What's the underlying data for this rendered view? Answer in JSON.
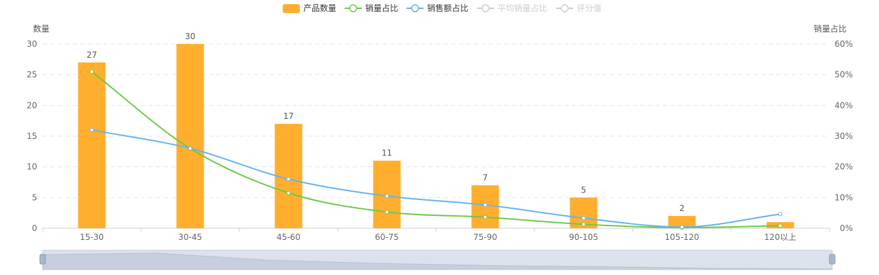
{
  "chart_data": {
    "type": "bar",
    "categories": [
      "15-30",
      "30-45",
      "45-60",
      "60-75",
      "75-90",
      "90-105",
      "105-120",
      "120以上"
    ],
    "y_left": {
      "name": "数量",
      "min": 0,
      "max": 30,
      "ticks": [
        0,
        5,
        10,
        15,
        20,
        25,
        30
      ]
    },
    "y_right": {
      "name": "销量占比",
      "min": 0,
      "max": 60,
      "ticks": [
        "0%",
        "10%",
        "20%",
        "30%",
        "40%",
        "50%",
        "60%"
      ]
    },
    "grid": true,
    "legend_position": "top-center",
    "series": [
      {
        "name": "产品数量",
        "kind": "bar",
        "axis": "left",
        "color": "#FFAE2E",
        "values": [
          27,
          30,
          17,
          11,
          7,
          5,
          2,
          1
        ],
        "labels": [
          "27",
          "30",
          "17",
          "11",
          "7",
          "5",
          "2",
          ""
        ]
      },
      {
        "name": "销量占比",
        "kind": "line",
        "axis": "right",
        "color": "#6DC94B",
        "values": [
          51,
          26,
          11.5,
          5.3,
          3.6,
          1.3,
          0.2,
          0.8
        ]
      },
      {
        "name": "销售额占比",
        "kind": "line",
        "axis": "right",
        "color": "#64B3F0",
        "values": [
          32,
          26,
          16,
          10.5,
          7.6,
          3.3,
          0.4,
          4.6
        ]
      },
      {
        "name": "平均销量占比",
        "kind": "line",
        "axis": "right",
        "color": "#CCCCCC",
        "hidden": true,
        "values": []
      },
      {
        "name": "评分值",
        "kind": "line",
        "axis": "right",
        "color": "#CCCCCC",
        "hidden": true,
        "values": []
      }
    ]
  }
}
